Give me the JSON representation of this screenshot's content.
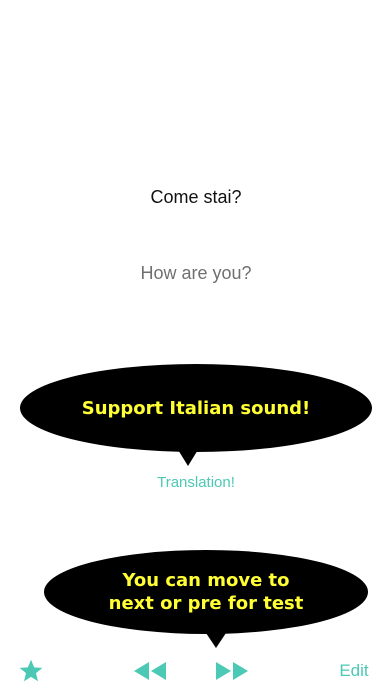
{
  "card": {
    "phrase": "Come stai?",
    "translation": "How are you?"
  },
  "callouts": {
    "sound": "Support Italian sound!",
    "navigate_line1": "You can move to",
    "navigate_line2": "next or pre for test"
  },
  "actions": {
    "translate_link": "Translation!",
    "edit_label": "Edit"
  },
  "icons": {
    "favorite": "star-icon",
    "previous": "rewind-icon",
    "next": "fast-forward-icon"
  },
  "colors": {
    "accent": "#4cc9b5",
    "callout_background": "#000000",
    "callout_text": "#ffff33"
  }
}
